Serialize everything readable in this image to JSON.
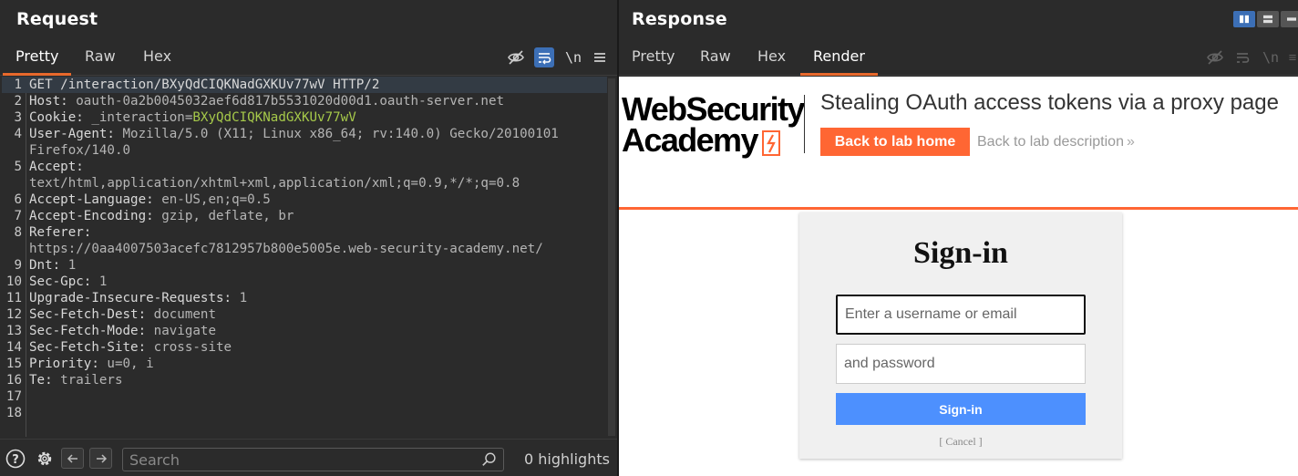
{
  "request": {
    "title": "Request",
    "tabs": [
      "Pretty",
      "Raw",
      "Hex"
    ],
    "lines": [
      {
        "n": "1",
        "name": "GET /interaction/BXyQdCIQKNadGXKUv77wV HTTP/2",
        "val": ""
      },
      {
        "n": "2",
        "name": "Host:",
        "val": " oauth-0a2b0045032aef6d817b5531020d00d1.oauth-server.net"
      },
      {
        "n": "3",
        "name": "Cookie:",
        "val": " _interaction=",
        "cookie": "BXyQdCIQKNadGXKUv77wV"
      },
      {
        "n": "4",
        "name": "User-Agent:",
        "val": " Mozilla/5.0 (X11; Linux x86_64; rv:140.0) Gecko/20100101"
      },
      {
        "n": "",
        "name": "",
        "val": "Firefox/140.0"
      },
      {
        "n": "5",
        "name": "Accept:",
        "val": ""
      },
      {
        "n": "",
        "name": "",
        "val": "text/html,application/xhtml+xml,application/xml;q=0.9,*/*;q=0.8"
      },
      {
        "n": "6",
        "name": "Accept-Language:",
        "val": " en-US,en;q=0.5"
      },
      {
        "n": "7",
        "name": "Accept-Encoding:",
        "val": " gzip, deflate, br"
      },
      {
        "n": "8",
        "name": "Referer:",
        "val": ""
      },
      {
        "n": "",
        "name": "",
        "val": "https://0aa4007503acefc7812957b800e5005e.web-security-academy.net/"
      },
      {
        "n": "9",
        "name": "Dnt:",
        "val": " 1"
      },
      {
        "n": "10",
        "name": "Sec-Gpc:",
        "val": " 1"
      },
      {
        "n": "11",
        "name": "Upgrade-Insecure-Requests:",
        "val": " 1"
      },
      {
        "n": "12",
        "name": "Sec-Fetch-Dest:",
        "val": " document"
      },
      {
        "n": "13",
        "name": "Sec-Fetch-Mode:",
        "val": " navigate"
      },
      {
        "n": "14",
        "name": "Sec-Fetch-Site:",
        "val": " cross-site"
      },
      {
        "n": "15",
        "name": "Priority:",
        "val": " u=0, i"
      },
      {
        "n": "16",
        "name": "Te:",
        "val": " trailers"
      },
      {
        "n": "17",
        "name": "",
        "val": ""
      },
      {
        "n": "18",
        "name": "",
        "val": ""
      }
    ],
    "search_placeholder": "Search",
    "highlights": "0 highlights",
    "newline_label": "\\n"
  },
  "response": {
    "title": "Response",
    "tabs": [
      "Pretty",
      "Raw",
      "Hex",
      "Render"
    ],
    "newline_label": "\\n",
    "render": {
      "logo_line1": "WebSecurity",
      "logo_line2": "Academy",
      "lab_title": "Stealing OAuth access tokens via a proxy page",
      "back_home": "Back to lab home",
      "back_description": "Back to lab description",
      "signin_title": "Sign-in",
      "username_placeholder": "Enter a username or email",
      "password_placeholder": "and password",
      "signin_button": "Sign-in",
      "cancel": "[ Cancel ]",
      "accent_color": "#ff6633",
      "button_color": "#4d90fe"
    }
  }
}
